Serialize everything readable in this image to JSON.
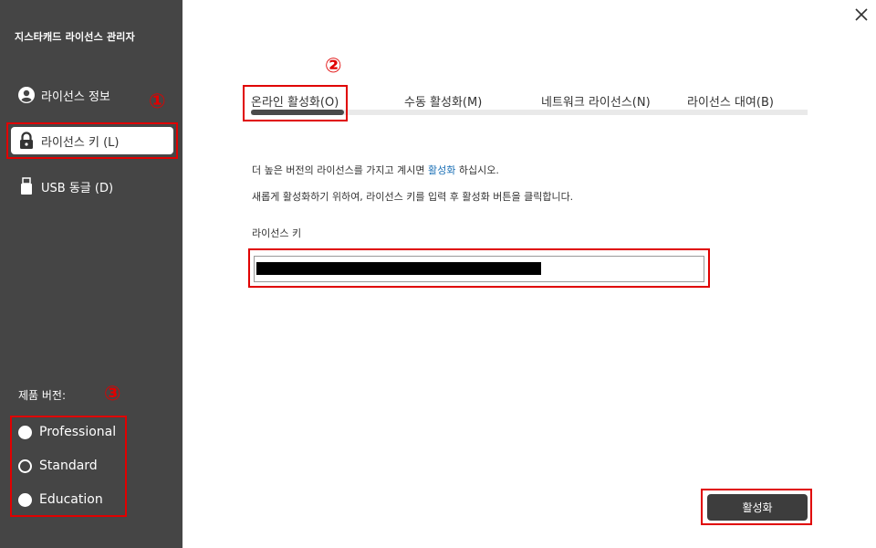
{
  "app": {
    "title": "지스타캐드 라이선스 관리자"
  },
  "sidebar": {
    "items": [
      {
        "label": "라이선스 정보",
        "icon": "user-circle-icon"
      },
      {
        "label": "라이선스 키 (L)",
        "icon": "lock-icon",
        "selected": true
      },
      {
        "label": "USB 동글 (D)",
        "icon": "usb-icon"
      }
    ],
    "version_label": "제품 버전:",
    "versions": [
      {
        "label": "Professional",
        "selected": true
      },
      {
        "label": "Standard",
        "selected": false
      },
      {
        "label": "Education",
        "selected": true
      }
    ]
  },
  "markers": {
    "m1": "①",
    "m2": "②",
    "m3": "③"
  },
  "tabs": [
    {
      "label": "온라인 활성화(O)",
      "active": true
    },
    {
      "label": "수동 활성화(M)",
      "active": false
    },
    {
      "label": "네트워크 라이선스(N)",
      "active": false
    },
    {
      "label": "라이선스 대여(B)",
      "active": false
    }
  ],
  "main": {
    "desc1_before": "더 높은 버전의 라이선스를 가지고 계시면 ",
    "desc1_link": "활성화",
    "desc1_after": " 하십시오.",
    "desc2": "새롭게 활성화하기 위하여, 라이선스 키를 입력 후 활성화 버튼을 클릭합니다.",
    "key_label": "라이선스 키",
    "key_value": "",
    "activate_label": "활성화"
  },
  "colors": {
    "sidebar_bg": "#454545",
    "accent_red": "#e00000",
    "link": "#1a6fb5",
    "button_bg": "#3d3d3d"
  }
}
